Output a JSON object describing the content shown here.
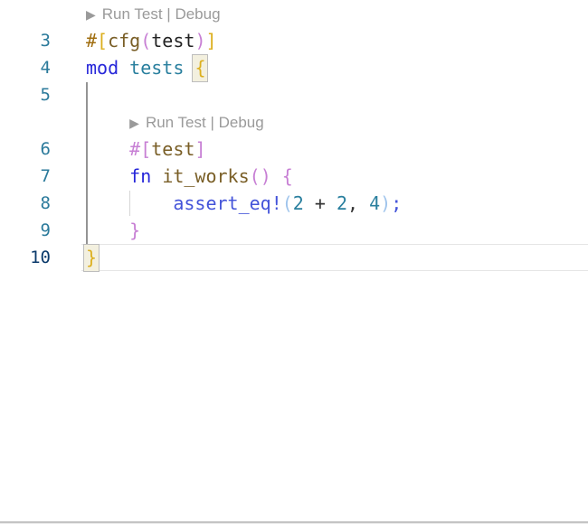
{
  "colors": {
    "keyword": "#2626D9",
    "macro": "#4353D9",
    "module": "#297F9E",
    "number": "#297F9E",
    "function": "#795E26",
    "attribute": "#795E26",
    "attr_hash": "#A06E10",
    "plain": "#222222",
    "operator": "#333333",
    "bracket1": "#DCAF1E",
    "bracket2": "#C77FD4",
    "bracket3": "#9FC4EC",
    "codelens_text": "#9A9A9A",
    "line_number": "#2B7A9B",
    "line_number_active": "#0B3A6B"
  },
  "codelens": {
    "play_icon": "▶",
    "run_label": "Run Test",
    "separator": "|",
    "debug_label": "Debug"
  },
  "rows": [
    {
      "kind": "codelens",
      "indent_col": 0
    },
    {
      "kind": "code",
      "number": "3",
      "active": false,
      "tokens": [
        [
          "#",
          "attr_hash"
        ],
        [
          "[",
          "bracket1"
        ],
        [
          "cfg",
          "attribute"
        ],
        [
          "(",
          "bracket2"
        ],
        [
          "test",
          "plain"
        ],
        [
          ")",
          "bracket2"
        ],
        [
          "]",
          "bracket1"
        ]
      ]
    },
    {
      "kind": "code",
      "number": "4",
      "active": false,
      "tokens": [
        [
          "mod",
          "keyword"
        ],
        [
          " ",
          "plain"
        ],
        [
          "tests",
          "module"
        ],
        [
          " ",
          "plain"
        ],
        [
          "{",
          "bracket1",
          "match"
        ]
      ]
    },
    {
      "kind": "code",
      "number": "5",
      "active": false,
      "tokens": []
    },
    {
      "kind": "codelens",
      "indent_col": 4
    },
    {
      "kind": "code",
      "number": "6",
      "active": false,
      "tokens": [
        [
          "    ",
          "plain"
        ],
        [
          "#",
          "bracket2"
        ],
        [
          "[",
          "bracket2"
        ],
        [
          "test",
          "attribute"
        ],
        [
          "]",
          "bracket2"
        ]
      ]
    },
    {
      "kind": "code",
      "number": "7",
      "active": false,
      "tokens": [
        [
          "    ",
          "plain"
        ],
        [
          "fn",
          "keyword"
        ],
        [
          " ",
          "plain"
        ],
        [
          "it_works",
          "function"
        ],
        [
          "(",
          "bracket2"
        ],
        [
          ")",
          "bracket2"
        ],
        [
          " ",
          "plain"
        ],
        [
          "{",
          "bracket2"
        ]
      ]
    },
    {
      "kind": "code",
      "number": "8",
      "active": false,
      "tokens": [
        [
          "        ",
          "plain"
        ],
        [
          "assert_eq!",
          "macro"
        ],
        [
          "(",
          "bracket3"
        ],
        [
          "2",
          "number"
        ],
        [
          " ",
          "plain"
        ],
        [
          "+",
          "operator"
        ],
        [
          " ",
          "plain"
        ],
        [
          "2",
          "number"
        ],
        [
          ",",
          "operator"
        ],
        [
          " ",
          "plain"
        ],
        [
          "4",
          "number"
        ],
        [
          ")",
          "bracket3"
        ],
        [
          ";",
          "macro"
        ]
      ]
    },
    {
      "kind": "code",
      "number": "9",
      "active": false,
      "tokens": [
        [
          "    ",
          "plain"
        ],
        [
          "}",
          "bracket2"
        ]
      ]
    },
    {
      "kind": "code",
      "number": "10",
      "active": true,
      "tokens": [
        [
          "}",
          "bracket1",
          "match"
        ]
      ]
    }
  ]
}
